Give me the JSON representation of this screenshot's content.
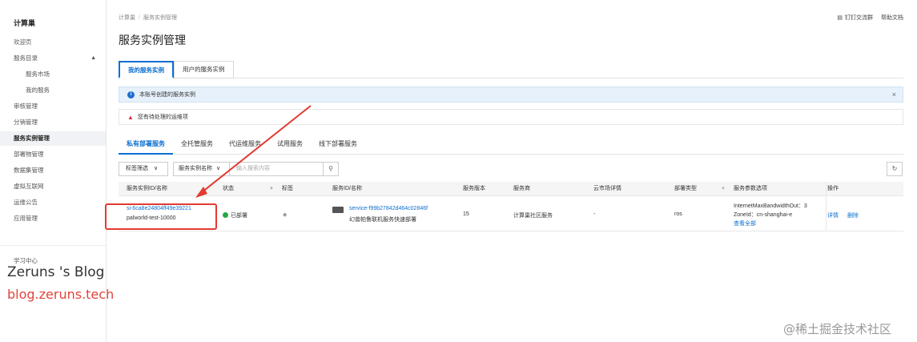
{
  "sidebar": {
    "title": "计算巢",
    "items": [
      {
        "label": "欢迎页"
      },
      {
        "label": "服务目录"
      },
      {
        "label": "服务市场"
      },
      {
        "label": "我的服务"
      },
      {
        "label": "审核管理"
      },
      {
        "label": "分销管理"
      },
      {
        "label": "服务实例管理"
      },
      {
        "label": "部署物管理"
      },
      {
        "label": "数据集管理"
      },
      {
        "label": "虚拟互联网"
      },
      {
        "label": "运维公告"
      },
      {
        "label": "应用管理"
      }
    ],
    "learn": "学习中心"
  },
  "header": {
    "breadcrumb": [
      "计算巢",
      "服务实例管理"
    ],
    "ding_label": "钉钉交流群",
    "help_label": "帮助文档",
    "title": "服务实例管理"
  },
  "tabs": [
    "我的服务实例",
    "用户的服务实例"
  ],
  "info_bar": {
    "text": "本账号创建的服务实例",
    "close": "×"
  },
  "warn_bar": {
    "text": "您有待处理的运维项"
  },
  "subtabs": [
    "私有部署服务",
    "全托管服务",
    "代运维服务",
    "试用服务",
    "线下部署服务"
  ],
  "filters": {
    "tag_filter": "标签筛选",
    "field_select": "服务实例名称",
    "search_placeholder": "输入搜索内容"
  },
  "table": {
    "headers": [
      "服务实例ID/名称",
      "状态",
      "标签",
      "服务ID/名称",
      "服务版本",
      "服务商",
      "云市场详情",
      "部署类型",
      "服务参数选项",
      "操作"
    ],
    "rows": [
      {
        "instance_id": "si-6ca8e24804ff49e39221",
        "instance_name": "palworld-test-10000",
        "status": "已部署",
        "service_id": "service-f99b27842d464c02846f",
        "service_name": "幻兽帕鲁联机服务快速部署",
        "version": "15",
        "provider": "计算巢社区服务",
        "market": "-",
        "deploy_type": "ros",
        "param1": "InternetMaxBandwidthOut：3",
        "param2": "ZoneId：cn-shanghai-e",
        "param_more": "查看全部",
        "op_detail": "详情",
        "op_delete": "删除"
      }
    ]
  },
  "watermarks": {
    "blog_name": "Zeruns 's Blog",
    "blog_url": "blog.zeruns.tech",
    "juejin": "@稀土掘金技术社区"
  },
  "colors": {
    "accent": "#0b6fd0",
    "annotation": "#e23b32",
    "status_ok": "#28a745"
  }
}
